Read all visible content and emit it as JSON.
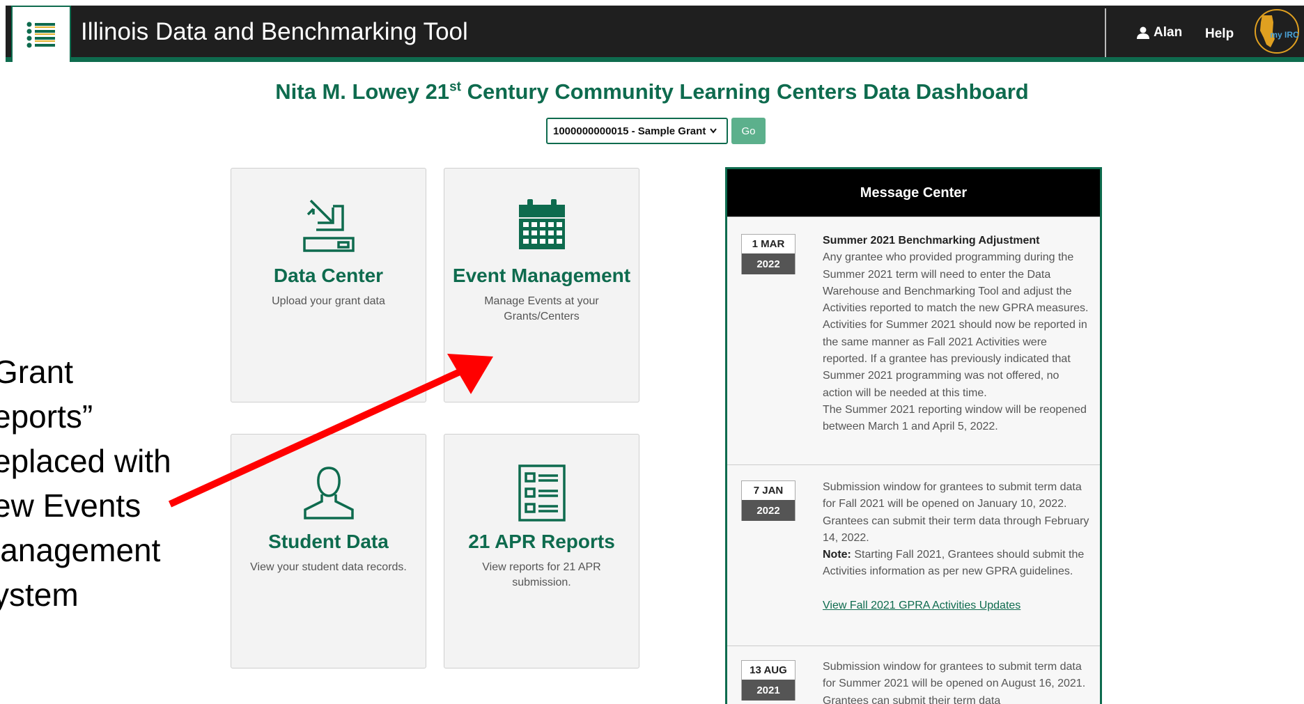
{
  "header": {
    "app_title": "Illinois Data and Benchmarking Tool",
    "user_name": "Alan",
    "help_label": "Help",
    "logo_text": "my IRC"
  },
  "page": {
    "title_pre": "Nita M. Lowey 21",
    "title_sup": "st",
    "title_post": " Century Community Learning Centers Data Dashboard",
    "grant_select_value": "1000000000015 - Sample Grant",
    "go_label": "Go"
  },
  "tiles": [
    {
      "name": "Data Center",
      "desc": "Upload your grant data",
      "icon": "upload-tray-icon"
    },
    {
      "name": "Event Management",
      "desc": "Manage Events at your Grants/Centers",
      "icon": "calendar-icon"
    },
    {
      "name": "Student Data",
      "desc": "View your student data records.",
      "icon": "user-icon"
    },
    {
      "name": "21 APR Reports",
      "desc": "View reports for 21 APR submission.",
      "icon": "report-list-icon"
    }
  ],
  "annotation": {
    "lines": [
      "Grant",
      "eports”",
      "eplaced with",
      "ew Events",
      "lanagement",
      "ystem"
    ],
    "arrow_color": "#ff0000"
  },
  "message_center": {
    "title": "Message Center",
    "messages": [
      {
        "day_month": "1 MAR",
        "year": "2022",
        "heading": "Summer 2021 Benchmarking Adjustment",
        "text": "Any grantee who provided programming during the Summer 2021 term will need to enter the Data Warehouse and Benchmarking Tool and adjust the Activities reported to match the new GPRA measures. Activities for Summer 2021 should now be reported in the same manner as Fall 2021 Activities were reported. If a grantee has previously indicated that Summer 2021 programming was not offered, no action will be needed at this time.",
        "text2": "The Summer 2021 reporting window will be reopened between March 1 and April 5, 2022."
      },
      {
        "day_month": "7 JAN",
        "year": "2022",
        "text": "Submission window for grantees to submit term data for Fall 2021 will be opened on January 10, 2022. Grantees can submit their term data through February 14, 2022.",
        "note_label": "Note:",
        "note_text": " Starting Fall 2021, Grantees should submit the Activities information as per new GPRA guidelines.",
        "link": "View Fall 2021 GPRA Activities Updates"
      },
      {
        "day_month": "13 AUG",
        "year": "2021",
        "text": "Submission window for grantees to submit term data for Summer 2021 will be opened on August 16, 2021. Grantees can submit their term data"
      }
    ]
  },
  "colors": {
    "brand_green": "#0e6b4e",
    "header_bg": "#1f1f1f",
    "go_button": "#5cb08c"
  }
}
